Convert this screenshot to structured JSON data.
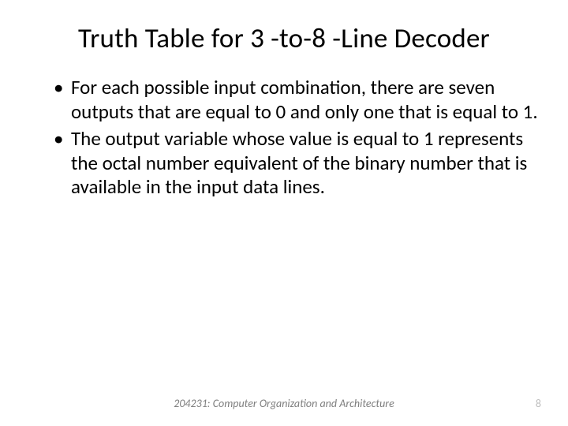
{
  "title": "Truth Table for 3 -to-8 -Line Decoder",
  "bullets": [
    "For each possible input combination, there are seven outputs that are equal to 0 and only one that is equal to 1.",
    "The output variable whose value is equal to 1 represents the octal number equivalent of the binary number that is available in the input data lines."
  ],
  "footer": {
    "course": "204231: Computer Organization and Architecture",
    "page": "8"
  }
}
